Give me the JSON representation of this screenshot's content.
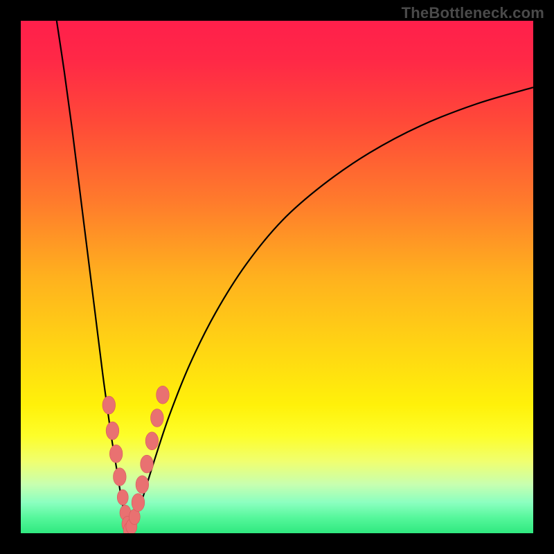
{
  "watermark": "TheBottleneck.com",
  "colors": {
    "frame": "#000000",
    "gradient_stops": [
      {
        "offset": 0.0,
        "color": "#ff1f4b"
      },
      {
        "offset": 0.08,
        "color": "#ff2946"
      },
      {
        "offset": 0.2,
        "color": "#ff4a38"
      },
      {
        "offset": 0.35,
        "color": "#ff7a2c"
      },
      {
        "offset": 0.5,
        "color": "#ffb11e"
      },
      {
        "offset": 0.63,
        "color": "#ffd314"
      },
      {
        "offset": 0.75,
        "color": "#fff10a"
      },
      {
        "offset": 0.81,
        "color": "#fdfe2a"
      },
      {
        "offset": 0.86,
        "color": "#f0ff70"
      },
      {
        "offset": 0.905,
        "color": "#c7ffb0"
      },
      {
        "offset": 0.94,
        "color": "#8bffc0"
      },
      {
        "offset": 0.97,
        "color": "#55f79b"
      },
      {
        "offset": 1.0,
        "color": "#2fe87f"
      }
    ],
    "curve": "#000000",
    "dot_fill": "#e97171",
    "dot_stroke": "#d55a5a"
  },
  "chart_data": {
    "type": "line",
    "title": "",
    "xlabel": "",
    "ylabel": "",
    "xlim": [
      0,
      100
    ],
    "ylim": [
      0,
      100
    ],
    "series": [
      {
        "name": "left-branch",
        "x": [
          7.0,
          8.5,
          10.0,
          11.5,
          13.0,
          14.5,
          16.0,
          17.5,
          18.8,
          19.6,
          20.3,
          20.8,
          21.1
        ],
        "y": [
          100,
          90,
          79,
          67,
          55,
          43,
          31,
          20,
          12,
          7,
          3.5,
          1.3,
          0.4
        ]
      },
      {
        "name": "right-branch",
        "x": [
          21.1,
          22.0,
          23.5,
          26.0,
          29.0,
          33.0,
          38.0,
          44.0,
          51.0,
          59.0,
          68.0,
          78.0,
          89.0,
          100.0
        ],
        "y": [
          0.4,
          2.0,
          6.0,
          14.0,
          23.0,
          33.0,
          43.0,
          52.5,
          61.0,
          68.0,
          74.2,
          79.5,
          83.8,
          87.0
        ]
      }
    ],
    "dots": [
      {
        "x": 17.2,
        "y": 25.0,
        "r": 1.4
      },
      {
        "x": 17.9,
        "y": 20.0,
        "r": 1.4
      },
      {
        "x": 18.6,
        "y": 15.5,
        "r": 1.4
      },
      {
        "x": 19.3,
        "y": 11.0,
        "r": 1.4
      },
      {
        "x": 19.9,
        "y": 7.0,
        "r": 1.2
      },
      {
        "x": 20.4,
        "y": 4.0,
        "r": 1.2
      },
      {
        "x": 20.8,
        "y": 1.8,
        "r": 1.2
      },
      {
        "x": 21.1,
        "y": 0.6,
        "r": 1.2
      },
      {
        "x": 21.6,
        "y": 1.3,
        "r": 1.2
      },
      {
        "x": 22.2,
        "y": 3.2,
        "r": 1.2
      },
      {
        "x": 22.9,
        "y": 6.0,
        "r": 1.4
      },
      {
        "x": 23.7,
        "y": 9.5,
        "r": 1.4
      },
      {
        "x": 24.6,
        "y": 13.5,
        "r": 1.4
      },
      {
        "x": 25.6,
        "y": 18.0,
        "r": 1.4
      },
      {
        "x": 26.6,
        "y": 22.5,
        "r": 1.4
      },
      {
        "x": 27.7,
        "y": 27.0,
        "r": 1.4
      }
    ]
  }
}
